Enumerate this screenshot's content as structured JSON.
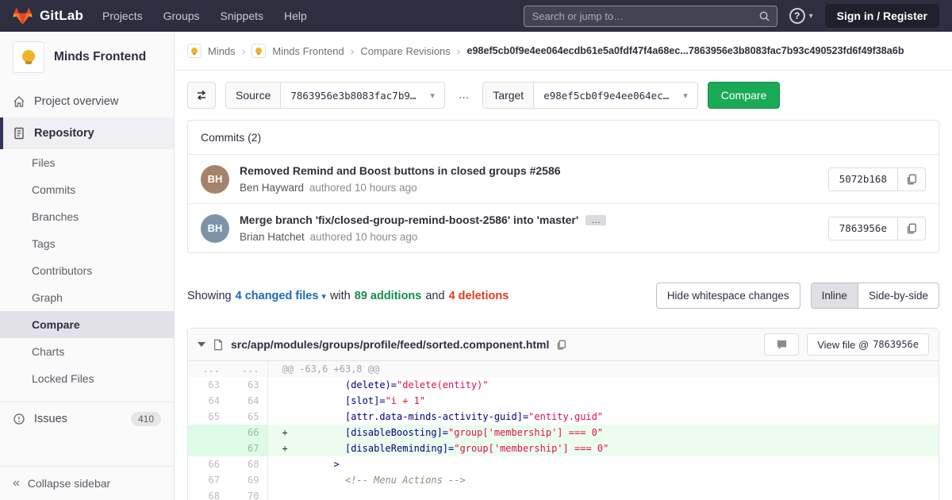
{
  "colors": {
    "navbar_bg": "#2e2e41",
    "green_button": "#1aaa55",
    "additions_green": "#168f48",
    "deletions_red": "#db3b21",
    "link_blue": "#1b69b6",
    "added_line_bg": "#ecfdf0",
    "added_num_bg": "#ddfbe6"
  },
  "icons": {
    "ellipsis": "…",
    "caret_down": "▾",
    "breadcrumb_sep": "›",
    "collapse": "«",
    "question": "?"
  },
  "navbar": {
    "brand": "GitLab",
    "items": [
      "Projects",
      "Groups",
      "Snippets",
      "Help"
    ],
    "search_placeholder": "Search or jump to…",
    "sign_in": "Sign in / Register"
  },
  "sidebar": {
    "project_name": "Minds Frontend",
    "overview_label": "Project overview",
    "repository_label": "Repository",
    "repo_items": [
      "Files",
      "Commits",
      "Branches",
      "Tags",
      "Contributors",
      "Graph",
      "Compare",
      "Charts",
      "Locked Files"
    ],
    "active_sub": "Compare",
    "issues_label": "Issues",
    "issues_count": "410",
    "collapse_label": "Collapse sidebar"
  },
  "breadcrumb": {
    "group": "Minds",
    "project": "Minds Frontend",
    "page": "Compare Revisions",
    "current": "e98ef5cb0f9e4ee064ecdb61e5a0fdf47f4a68ec...7863956e3b8083fac7b93c490523fd6f49f38a6b"
  },
  "compare_form": {
    "source_label": "Source",
    "source_value": "7863956e3b8083fac7b9…",
    "separator": "...",
    "target_label": "Target",
    "target_value": "e98ef5cb0f9e4ee064ec…",
    "compare_button": "Compare"
  },
  "commits": {
    "header": "Commits (2)",
    "items": [
      {
        "title": "Removed Remind and Boost buttons in closed groups #2586",
        "author": "Ben Hayward",
        "authored": "authored 10 hours ago",
        "sha": "5072b168",
        "initials": "BH",
        "avatar_color": "#a3846b"
      },
      {
        "title": "Merge branch 'fix/closed-group-remind-boost-2586' into 'master'",
        "author": "Brian Hatchet",
        "authored": "authored 10 hours ago",
        "sha": "7863956e",
        "initials": "BH",
        "avatar_color": "#7d94a8"
      }
    ]
  },
  "summary": {
    "showing": "Showing",
    "changed_files": "4 changed files",
    "with_word": "with",
    "additions": "89 additions",
    "and_word": "and",
    "deletions": "4 deletions",
    "hide_whitespace": "Hide whitespace changes",
    "inline": "Inline",
    "side_by_side": "Side-by-side"
  },
  "diff": {
    "file_path": "src/app/modules/groups/profile/feed/sorted.component.html",
    "view_file_label": "View file @",
    "view_file_sha": "7863956e",
    "lines": [
      {
        "type": "hunk",
        "old": "...",
        "new": "...",
        "segments": [
          {
            "cls": "hunk",
            "text": "@@ -63,6 +63,8 @@"
          }
        ]
      },
      {
        "type": "context",
        "old": "63",
        "new": "63",
        "segments": [
          {
            "cls": "plain",
            "text": "           "
          },
          {
            "cls": "attr",
            "text": "(delete)="
          },
          {
            "cls": "str",
            "text": "\"delete(entity)\""
          }
        ]
      },
      {
        "type": "context",
        "old": "64",
        "new": "64",
        "segments": [
          {
            "cls": "plain",
            "text": "           "
          },
          {
            "cls": "attr",
            "text": "[slot]="
          },
          {
            "cls": "str",
            "text": "\"i + 1\""
          }
        ]
      },
      {
        "type": "context",
        "old": "65",
        "new": "65",
        "segments": [
          {
            "cls": "plain",
            "text": "           "
          },
          {
            "cls": "attr",
            "text": "[attr.data-minds-activity-guid]="
          },
          {
            "cls": "str",
            "text": "\"entity.guid\""
          }
        ]
      },
      {
        "type": "added",
        "old": "",
        "new": "66",
        "segments": [
          {
            "cls": "plain",
            "text": "+          "
          },
          {
            "cls": "attr",
            "text": "[disableBoosting]="
          },
          {
            "cls": "str",
            "text": "\"group['membership'] === 0\""
          }
        ]
      },
      {
        "type": "added",
        "old": "",
        "new": "67",
        "segments": [
          {
            "cls": "plain",
            "text": "+          "
          },
          {
            "cls": "attr",
            "text": "[disableReminding]="
          },
          {
            "cls": "str",
            "text": "\"group['membership'] === 0\""
          }
        ]
      },
      {
        "type": "context",
        "old": "66",
        "new": "68",
        "segments": [
          {
            "cls": "plain",
            "text": "         "
          },
          {
            "cls": "attr",
            "text": ">"
          }
        ]
      },
      {
        "type": "context",
        "old": "67",
        "new": "69",
        "segments": [
          {
            "cls": "plain",
            "text": "           "
          },
          {
            "cls": "comment",
            "text": "<!-- Menu Actions -->"
          }
        ]
      },
      {
        "type": "context",
        "old": "68",
        "new": "70",
        "segments": []
      }
    ]
  }
}
